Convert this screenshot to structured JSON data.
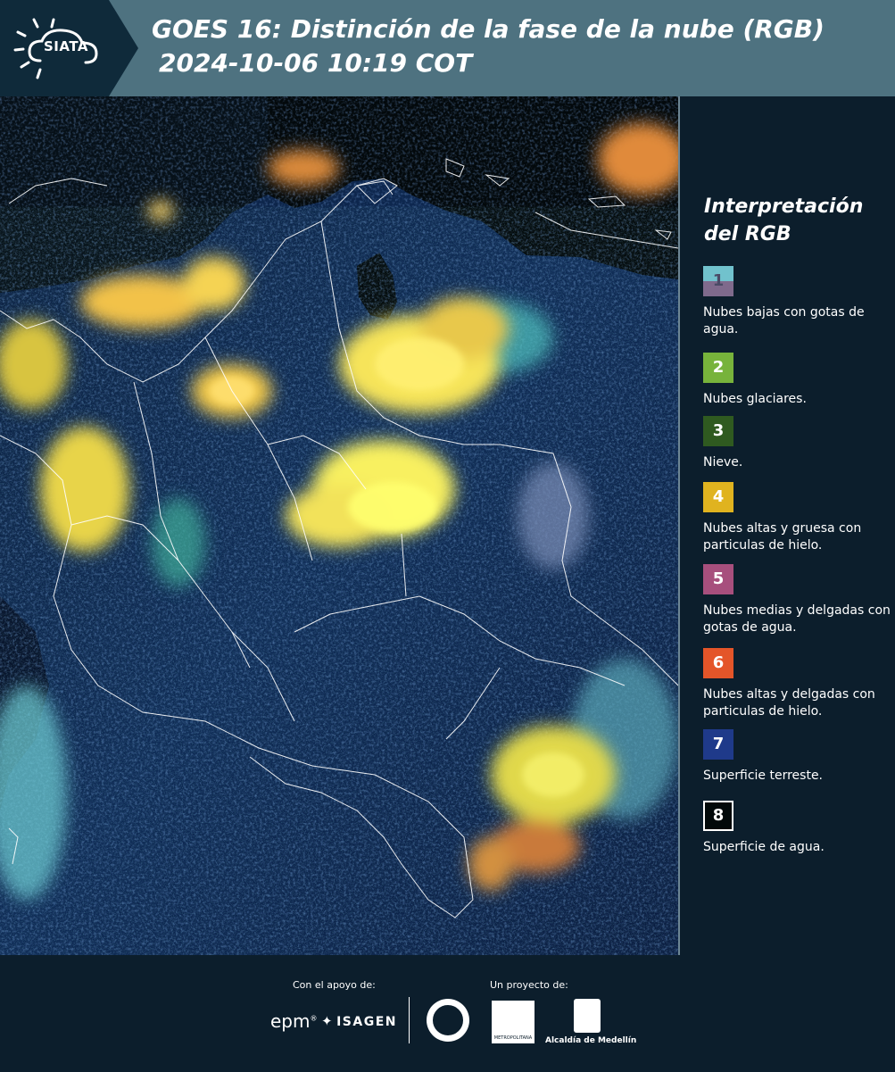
{
  "header": {
    "logo_text": "SIATA",
    "title_line1": "GOES 16: Distinción de la fase de la nube (RGB)",
    "title_line2": "2024-10-06 10:19 COT"
  },
  "legend": {
    "title": "Interpretación del RGB",
    "items": [
      {
        "number": "1",
        "label": "Nubes bajas con gotas de agua.",
        "color": "#71c2cd"
      },
      {
        "number": "2",
        "label": "Nubes glaciares.",
        "color": "#77b33b"
      },
      {
        "number": "3",
        "label": "Nieve.",
        "color": "#2f5a20"
      },
      {
        "number": "4",
        "label": "Nubes altas y gruesa con particulas de hielo.",
        "color": "#e0b31f"
      },
      {
        "number": "5",
        "label": "Nubes medias y delgadas con gotas de agua.",
        "color": "#a74f7d"
      },
      {
        "number": "6",
        "label": "Nubes altas y delgadas con particulas de hielo.",
        "color": "#e45529"
      },
      {
        "number": "7",
        "label": "Superficie terreste.",
        "color": "#1f3a8a"
      },
      {
        "number": "8",
        "label": "Superficie de agua.",
        "color": "#02090a"
      }
    ]
  },
  "footer": {
    "support_caption": "Con el apoyo de:",
    "project_caption": "Un proyecto de:",
    "epm": "epm",
    "isagen": "ISAGEN",
    "area_text": "METROPOLITANA",
    "alcaldia": "Alcaldía de Medellín"
  }
}
